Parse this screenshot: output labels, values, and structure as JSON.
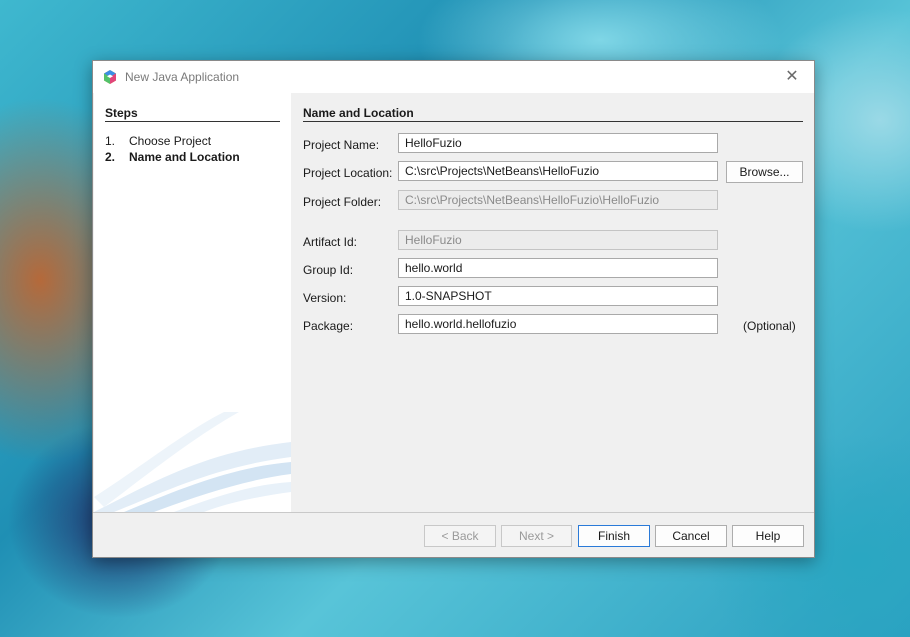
{
  "window": {
    "title": "New Java Application",
    "close_glyph": "✕"
  },
  "steps": {
    "heading": "Steps",
    "items": [
      {
        "number": "1.",
        "label": "Choose Project",
        "active": false
      },
      {
        "number": "2.",
        "label": "Name and Location",
        "active": true
      }
    ]
  },
  "form": {
    "heading": "Name and Location",
    "project_name": {
      "label": "Project Name:",
      "value": "HelloFuzio"
    },
    "project_location": {
      "label": "Project Location:",
      "value": "C:\\src\\Projects\\NetBeans\\HelloFuzio"
    },
    "browse_label": "Browse...",
    "project_folder": {
      "label": "Project Folder:",
      "value": "C:\\src\\Projects\\NetBeans\\HelloFuzio\\HelloFuzio"
    },
    "artifact_id": {
      "label": "Artifact Id:",
      "value": "HelloFuzio"
    },
    "group_id": {
      "label": "Group Id:",
      "value": "hello.world"
    },
    "version": {
      "label": "Version:",
      "value": "1.0-SNAPSHOT"
    },
    "package": {
      "label": "Package:",
      "value": "hello.world.hellofuzio",
      "optional_label": "(Optional)"
    }
  },
  "buttons": {
    "back": "< Back",
    "next": "Next >",
    "finish": "Finish",
    "cancel": "Cancel",
    "help": "Help"
  },
  "icons": {
    "app": "netbeans-cube-icon",
    "close": "close-icon"
  }
}
